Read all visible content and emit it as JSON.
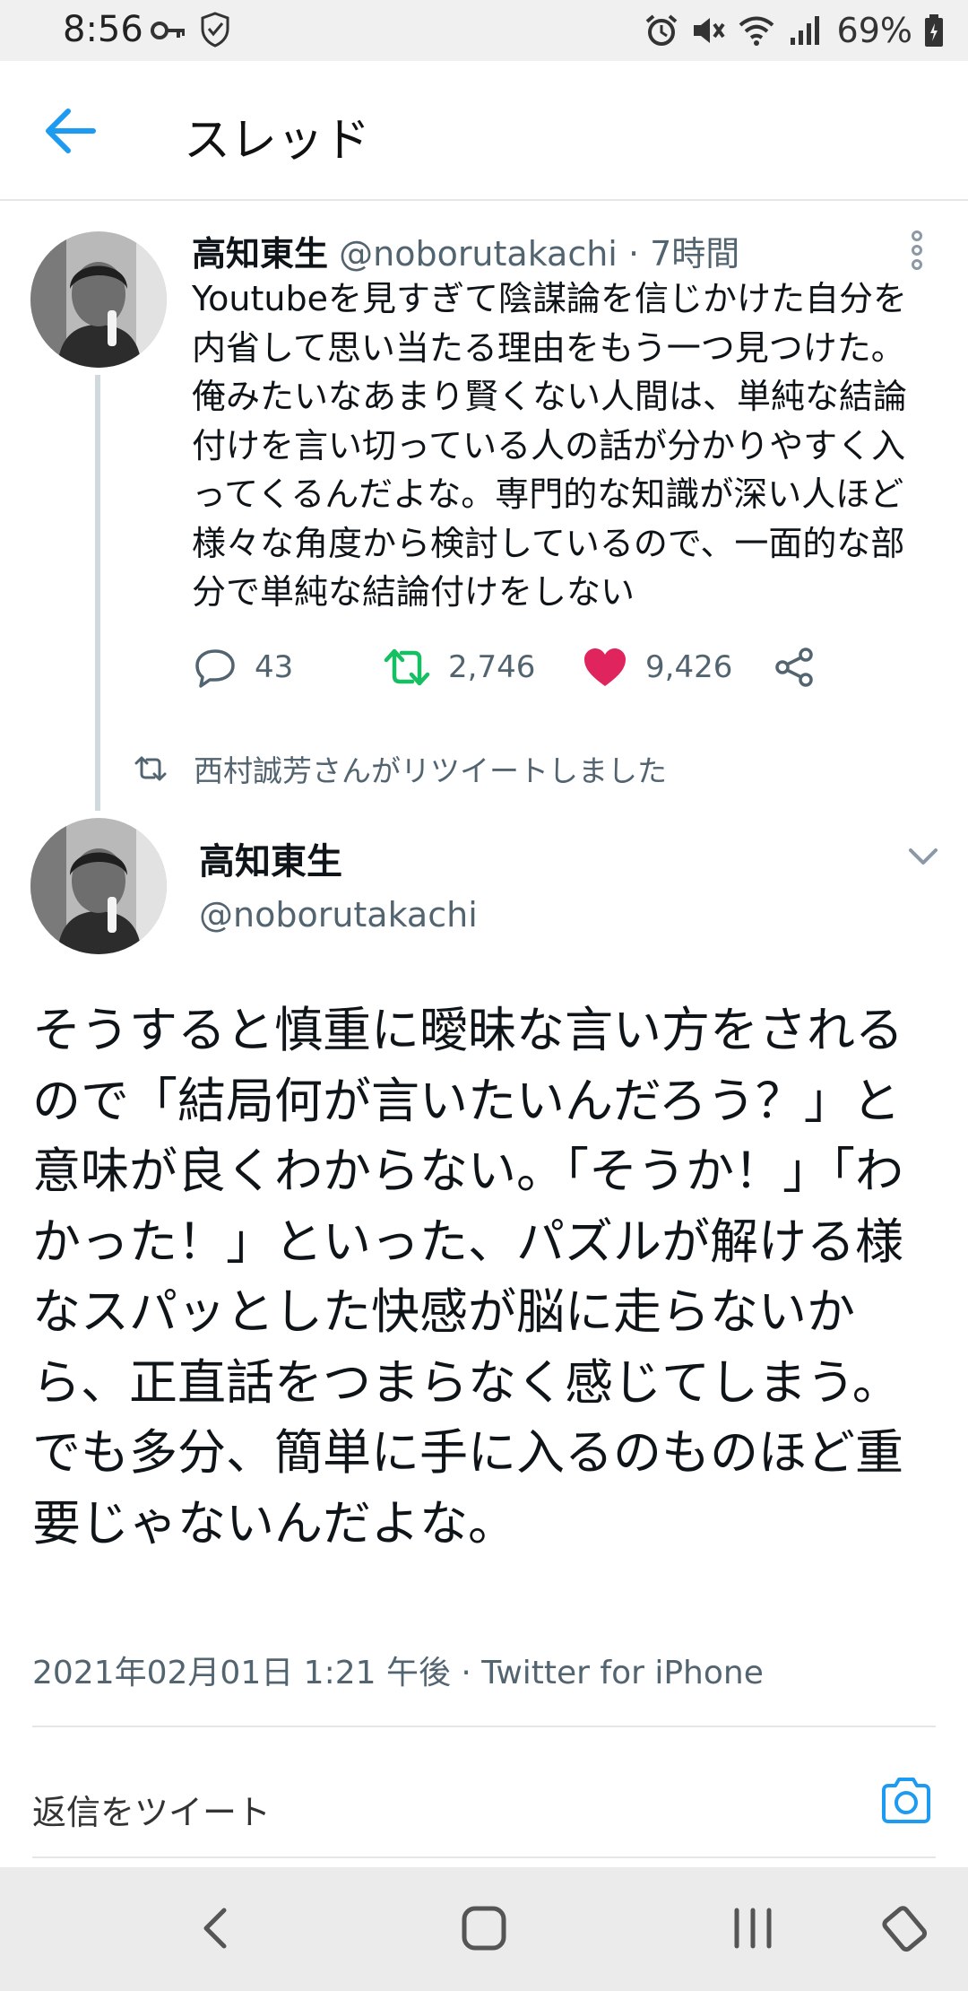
{
  "status_bar": {
    "time": "8:56",
    "battery": "69%"
  },
  "app_bar": {
    "title": "スレッド"
  },
  "tweet1": {
    "name": "高知東生",
    "handle": "@noborutakachi",
    "time": "· 7時間",
    "text": "Youtubeを見すぎて陰謀論を信じかけた自分を内省して思い当たる理由をもう一つ見つけた。俺みたいなあまり賢くない人間は、単純な結論付けを言い切っている人の話が分かりやすく入ってくるんだよな。専門的な知識が深い人ほど様々な角度から検討しているので、一面的な部分で単純な結論付けをしない",
    "replies": "43",
    "retweets": "2,746",
    "likes": "9,426"
  },
  "retweet_note": "西村誠芳さんがリツイートしました",
  "tweet2": {
    "name": "高知東生",
    "handle": "@noborutakachi",
    "text": "そうすると慎重に曖昧な言い方をされるので「結局何が言いたいんだろう？」と意味が良くわからない。「そうか！」「わかった！」といった、パズルが解ける様なスパッとした快感が脳に走らないから、正直話をつまらなく感じてしまう。でも多分、簡単に手に入るのものほど重要じゃないんだよな。",
    "meta": "2021年02月01日 1:21 午後 · Twitter for iPhone"
  },
  "reply_bar": {
    "placeholder": "返信をツイート"
  },
  "colors": {
    "accent_blue": "#1d9bf0",
    "retweet_green": "#17bf63",
    "like_pink": "#e0245e",
    "muted_text": "#536471"
  }
}
